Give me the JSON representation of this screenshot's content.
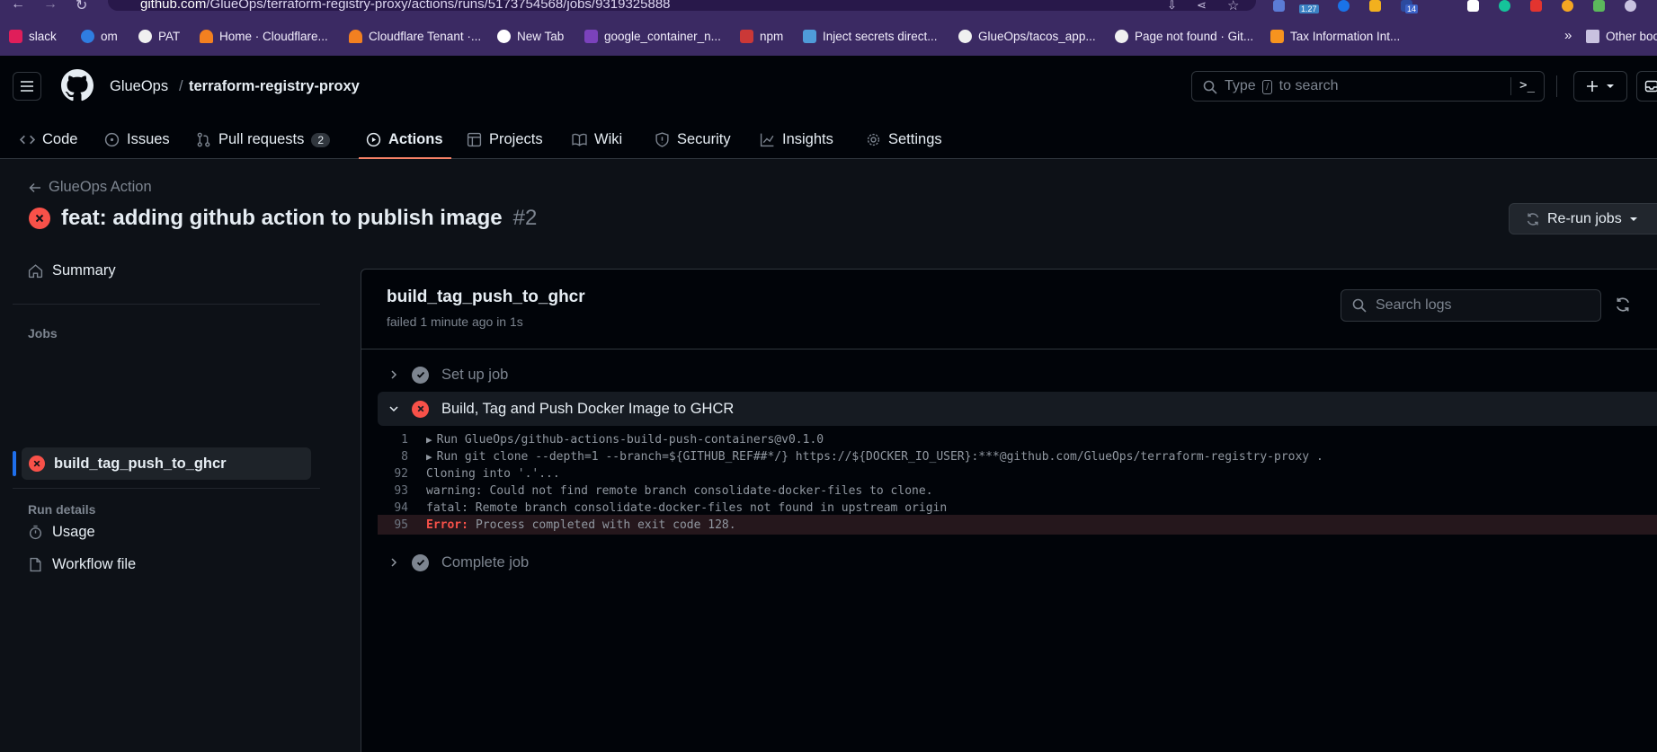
{
  "browser": {
    "url_host": "github.com",
    "url_path": "/GlueOps/terraform-registry-proxy/actions/runs/5173754568/jobs/9319325888",
    "extension_badges": [
      "1.27",
      "14"
    ],
    "bookmarks": [
      {
        "label": "slack",
        "icon": "slack-icon",
        "color": "#e01e5a"
      },
      {
        "label": "om",
        "icon": "om-icon",
        "color": "#2f7de1"
      },
      {
        "label": "PAT",
        "icon": "github-icon",
        "color": "#f0f0f0"
      },
      {
        "label": "Home · Cloudflare...",
        "icon": "cloudflare-icon",
        "color": "#f38020"
      },
      {
        "label": "Cloudflare Tenant ·...",
        "icon": "cloudflare-icon",
        "color": "#f38020"
      },
      {
        "label": "New Tab",
        "icon": "globe-icon",
        "color": "#ffffff"
      },
      {
        "label": "google_container_n...",
        "icon": "terraform-icon",
        "color": "#7b42bc"
      },
      {
        "label": "npm",
        "icon": "npm-icon",
        "color": "#cb3837"
      },
      {
        "label": "Inject secrets direct...",
        "icon": "vault-icon",
        "color": "#4f9bd9"
      },
      {
        "label": "GlueOps/tacos_app...",
        "icon": "github-icon",
        "color": "#f0f0f0"
      },
      {
        "label": "Page not found · Git...",
        "icon": "github-icon",
        "color": "#f0f0f0"
      },
      {
        "label": "Tax Information Int...",
        "icon": "box-icon",
        "color": "#f7931e"
      }
    ],
    "more_bookmarks_label": "»",
    "other_bookmarks_label": "Other boo"
  },
  "header": {
    "owner": "GlueOps",
    "separator": "/",
    "repo": "terraform-registry-proxy",
    "search_prefix": "Type",
    "search_key": "/",
    "search_suffix": "to search",
    "terminal_glyph": ">_"
  },
  "tabs": [
    {
      "label": "Code",
      "icon": "code-icon"
    },
    {
      "label": "Issues",
      "icon": "issue-icon"
    },
    {
      "label": "Pull requests",
      "icon": "pull-request-icon",
      "count": "2"
    },
    {
      "label": "Actions",
      "icon": "actions-play-icon",
      "active": true
    },
    {
      "label": "Projects",
      "icon": "table-icon"
    },
    {
      "label": "Wiki",
      "icon": "book-icon"
    },
    {
      "label": "Security",
      "icon": "shield-icon"
    },
    {
      "label": "Insights",
      "icon": "graph-icon"
    },
    {
      "label": "Settings",
      "icon": "gear-icon"
    }
  ],
  "run": {
    "back_label": "GlueOps Action",
    "title": "feat: adding github action to publish image",
    "number": "#2",
    "rerun_label": "Re-run jobs"
  },
  "sidebar": {
    "summary_label": "Summary",
    "jobs_heading": "Jobs",
    "job_label": "build_tag_push_to_ghcr",
    "run_details_heading": "Run details",
    "usage_label": "Usage",
    "workflow_label": "Workflow file"
  },
  "job": {
    "name": "build_tag_push_to_ghcr",
    "meta": "failed 1 minute ago in 1s",
    "search_placeholder": "Search logs",
    "steps": [
      {
        "label": "Set up job",
        "status": "success",
        "expanded": false
      },
      {
        "label": "Build, Tag and Push Docker Image to GHCR",
        "status": "failure",
        "expanded": true
      },
      {
        "label": "Complete job",
        "status": "success",
        "expanded": false
      }
    ],
    "log_lines": [
      {
        "num": "1",
        "text": "Run GlueOps/github-actions-build-push-containers@v0.1.0",
        "collapsible": true
      },
      {
        "num": "8",
        "text": "Run git clone --depth=1 --branch=${GITHUB_REF##*/} https://${DOCKER_IO_USER}:***@github.com/GlueOps/terraform-registry-proxy .",
        "collapsible": true
      },
      {
        "num": "92",
        "text": "Cloning into '.'..."
      },
      {
        "num": "93",
        "text": "warning: Could not find remote branch consolidate-docker-files to clone."
      },
      {
        "num": "94",
        "text": "fatal: Remote branch consolidate-docker-files not found in upstream origin"
      },
      {
        "num": "95",
        "error_label": "Error:",
        "text": "Process completed with exit code 128."
      }
    ]
  }
}
